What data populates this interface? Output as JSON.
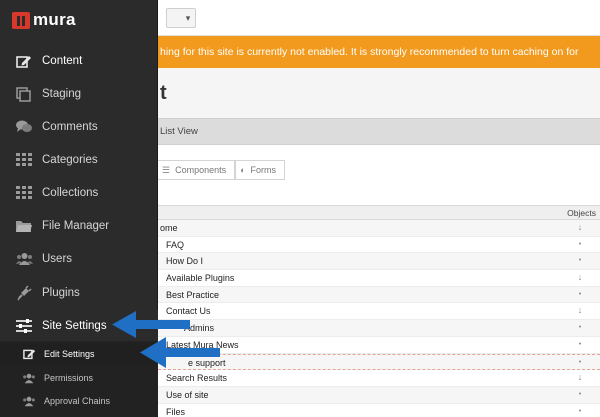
{
  "app": {
    "logo_text": "mura"
  },
  "sidebar": {
    "items": [
      {
        "label": "Content",
        "icon": "edit-icon"
      },
      {
        "label": "Staging",
        "icon": "copy-icon"
      },
      {
        "label": "Comments",
        "icon": "comments-icon"
      },
      {
        "label": "Categories",
        "icon": "grid-icon"
      },
      {
        "label": "Collections",
        "icon": "grid-icon"
      },
      {
        "label": "File Manager",
        "icon": "folder-icon"
      },
      {
        "label": "Users",
        "icon": "users-icon"
      },
      {
        "label": "Plugins",
        "icon": "plug-icon"
      },
      {
        "label": "Site Settings",
        "icon": "sliders-icon"
      }
    ],
    "subitems": [
      {
        "label": "Edit Settings",
        "icon": "edit-icon"
      },
      {
        "label": "Permissions",
        "icon": "users-icon"
      },
      {
        "label": "Approval Chains",
        "icon": "users-icon"
      }
    ]
  },
  "alert": {
    "text": "hing for this site is currently not enabled. It is strongly recommended to turn caching on for"
  },
  "page": {
    "title": "t"
  },
  "viewbar": {
    "label": "List View"
  },
  "tabs": [
    {
      "label": "Components",
      "icon": "list-icon"
    },
    {
      "label": "Forms",
      "icon": "toggle-icon"
    }
  ],
  "table": {
    "header": {
      "objects": "Objects"
    },
    "rows": [
      {
        "name": "ome",
        "obj": "↓"
      },
      {
        "name": "FAQ",
        "obj": "•"
      },
      {
        "name": "How Do I",
        "obj": "•"
      },
      {
        "name": "Available Plugins",
        "obj": "↓"
      },
      {
        "name": "Best Practice",
        "obj": "•"
      },
      {
        "name": "Contact Us",
        "obj": "↓"
      },
      {
        "name": "Admins",
        "obj": "•"
      },
      {
        "name": "Latest Mura News",
        "obj": "•"
      },
      {
        "name": "e support",
        "obj": "•"
      },
      {
        "name": "Search Results",
        "obj": "↓"
      },
      {
        "name": "Use of site",
        "obj": "•"
      },
      {
        "name": "Files",
        "obj": "•"
      }
    ]
  },
  "colors": {
    "sidebar_bg": "#2b2b2b",
    "alert_bg": "#f29a1e",
    "logo_red": "#d8382c",
    "arrow_blue": "#1f6fc5"
  }
}
